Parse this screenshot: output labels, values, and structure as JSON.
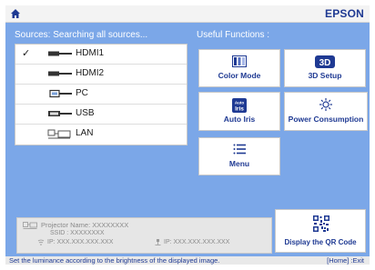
{
  "header": {
    "brand": "EPSON",
    "home_icon": "home-icon"
  },
  "sources": {
    "heading": "Sources: Searching all sources...",
    "items": [
      {
        "label": "HDMI1",
        "icon": "hdmi-cable-icon",
        "selected": true,
        "check": "✓"
      },
      {
        "label": "HDMI2",
        "icon": "hdmi-cable-icon",
        "selected": false
      },
      {
        "label": "PC",
        "icon": "vga-cable-icon",
        "selected": false
      },
      {
        "label": "USB",
        "icon": "usb-cable-icon",
        "selected": false
      },
      {
        "label": "LAN",
        "icon": "lan-icon",
        "selected": false
      }
    ]
  },
  "functions": {
    "heading": "Useful Functions :",
    "tiles": [
      {
        "label": "Color Mode",
        "icon": "color-mode-icon"
      },
      {
        "label": "3D Setup",
        "icon": "3d-icon",
        "icon_text": "3D"
      },
      {
        "label": "Auto Iris",
        "icon": "auto-iris-icon",
        "icon_text_small": "Auto",
        "icon_text": "Iris"
      },
      {
        "label": "Power Consumption",
        "icon": "power-consumption-icon"
      },
      {
        "label": "Menu",
        "icon": "menu-icon"
      }
    ]
  },
  "info": {
    "name_label": "Projector Name: XXXXXXXX",
    "ssid": "SSID : XXXXXXXX",
    "ip1": "IP:  XXX.XXX.XXX.XXX",
    "ip2": "IP:  XXX.XXX.XXX.XXX"
  },
  "qr": {
    "label": "Display the QR Code",
    "icon": "qr-code-icon"
  },
  "status": {
    "text": "Set the luminance according to the brightness of the displayed image.",
    "exit_hint": "[Home] :Exit"
  },
  "colors": {
    "background": "#7ba7e8",
    "accent": "#1f3a93",
    "panel": "#ffffff",
    "info_panel": "#e6e6e6"
  }
}
